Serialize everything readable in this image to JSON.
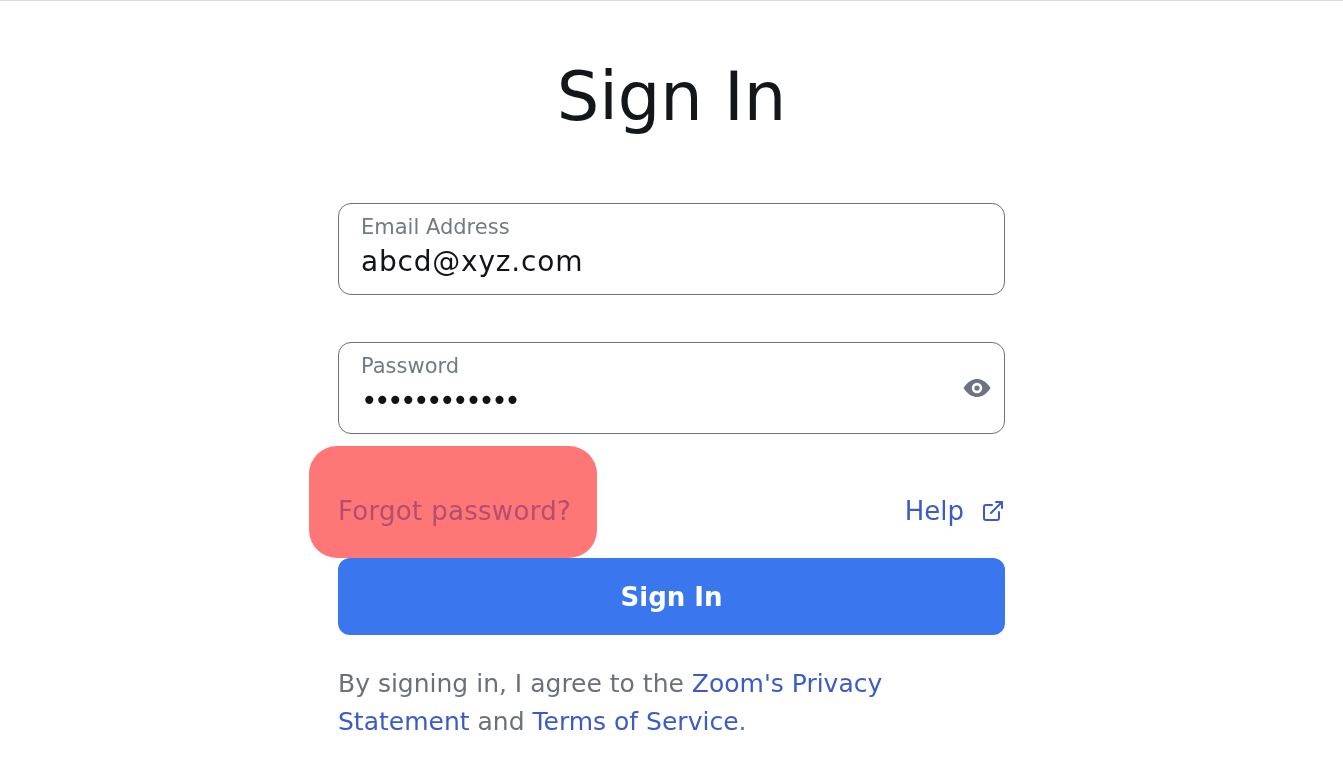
{
  "title": "Sign In",
  "fields": [
    {
      "kind": "email",
      "label": "Email Address",
      "value": "abcd@xyz.com"
    },
    {
      "kind": "password",
      "label": "Password",
      "value": "••••••••••••"
    }
  ],
  "forgot_password": {
    "label": "Forgot password?",
    "highlighted": true
  },
  "help_link": {
    "label": "Help"
  },
  "submit_button": {
    "label": "Sign In"
  },
  "terms_notice": {
    "lines": [
      [
        {
          "kind": "text",
          "text": "By signing in, I agree to the "
        },
        {
          "kind": "link",
          "text": "Zoom's Privacy"
        }
      ],
      [
        {
          "kind": "link",
          "text": "Statement"
        },
        {
          "kind": "text",
          "text": " and "
        },
        {
          "kind": "link",
          "text": "Terms of Service"
        },
        {
          "kind": "text",
          "text": "."
        }
      ]
    ]
  }
}
